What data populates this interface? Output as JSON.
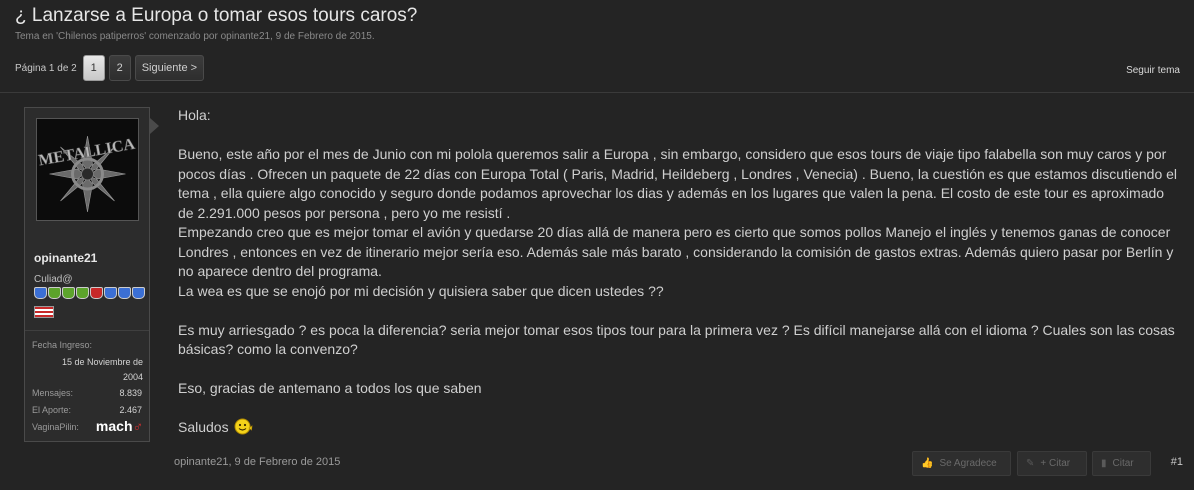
{
  "thread": {
    "title": "¿ Lanzarse a Europa o tomar esos tours caros?",
    "meta": "Tema en 'Chilenos patiperros' comenzado por opinante21, 9 de Febrero de 2015."
  },
  "pagenav": {
    "label": "Página 1 de 2",
    "pages": [
      "1",
      "2"
    ],
    "current_page": "1",
    "next_label": "Siguiente >"
  },
  "follow_label": "Seguir tema",
  "user": {
    "name": "opinante21",
    "title": "Culiad@",
    "badge_count": 8,
    "stats": {
      "joined_label": "Fecha Ingreso:",
      "joined_value": "15 de Noviembre de 2004",
      "messages_label": "Mensajes:",
      "messages_value": "8.839",
      "aporte_label": "El Aporte:",
      "aporte_value": "2.467",
      "vagina_label": "VaginaPilin:",
      "vagina_value": "mach",
      "vagina_symbol": "♂"
    }
  },
  "post": {
    "greeting": "Hola:",
    "p1": "Bueno, este año por el mes de Junio con mi polola queremos salir a Europa , sin embargo, considero que esos tours de viaje tipo falabella son muy caros y por pocos días . Ofrecen un paquete de 22 días con Europa Total ( Paris, Madrid, Heildeberg , Londres , Venecia) . Bueno, la cuestión es que estamos discutiendo el tema , ella quiere algo conocido y seguro donde podamos aprovechar los dias y además en los lugares que valen la pena. El costo de este tour es aproximado de 2.291.000 pesos por persona , pero yo me resistí .",
    "p2": "Empezando creo que es mejor tomar el avión y quedarse 20 días allá de manera pero es cierto que somos pollos Manejo el inglés y tenemos ganas de conocer Londres , entonces en vez de itinerario mejor sería eso. Además sale más barato , considerando la comisión de gastos extras. Además quiero pasar por Berlín y no aparece dentro del programa.",
    "p3": "La wea es que se enojó por mi decisión y quisiera saber que dicen ustedes ??",
    "p4": "Es muy arriesgado ? es poca la diferencia? seria mejor tomar esos tipos tour para la primera vez ? Es difícil manejarse allá con el idioma ? Cuales son las cosas básicas? como la convenzo?",
    "p5": "Eso, gracias de antemano a todos los que saben",
    "closing": "Saludos",
    "footer_meta": "opinante21, 9 de Febrero de 2015",
    "post_number": "#1"
  },
  "actions": {
    "like": "Se Agradece",
    "multiquote": "+ Citar",
    "reply": "Citar"
  },
  "icons": {
    "like": "thumbs-up-icon",
    "multiquote": "pencil-icon",
    "reply": "speech-bubble-icon",
    "smiley": "smiley-icon",
    "avatar": "metallica-logo"
  },
  "colors": {
    "background": "#242424",
    "text": "#cfcfcf",
    "title": "#e6e6e6",
    "gender_symbol": "#d83030"
  }
}
